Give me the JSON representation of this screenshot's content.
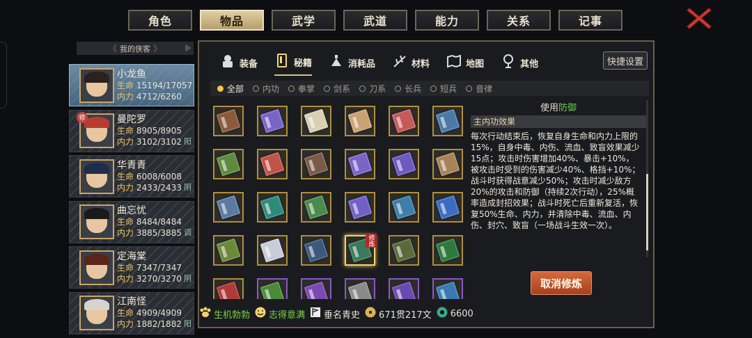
{
  "top_tabs": [
    {
      "label": "角色",
      "active": false
    },
    {
      "label": "物品",
      "active": true
    },
    {
      "label": "武学",
      "active": false
    },
    {
      "label": "武道",
      "active": false
    },
    {
      "label": "能力",
      "active": false
    },
    {
      "label": "关系",
      "active": false
    },
    {
      "label": "记事",
      "active": false
    }
  ],
  "close_icon": "close-x-icon",
  "left": {
    "header_label": "我的侠客",
    "characters": [
      {
        "name": "小龙鱼",
        "hp_label": "生命",
        "hp": "15194/17057",
        "mp_label": "内力",
        "mp": "4712/6260",
        "tag": "",
        "selected": true,
        "badge": "",
        "hair": "#2a221c"
      },
      {
        "name": "曼陀罗",
        "hp_label": "生命",
        "hp": "8905/8905",
        "mp_label": "内力",
        "mp": "3102/3102",
        "tag": "阳",
        "selected": false,
        "badge": "修",
        "hair": "#b83b32"
      },
      {
        "name": "华青青",
        "hp_label": "生命",
        "hp": "6008/6008",
        "mp_label": "内力",
        "mp": "2433/2433",
        "tag": "阴",
        "selected": false,
        "badge": "",
        "hair": "#1e2d4a"
      },
      {
        "name": "曲忘忧",
        "hp_label": "生命",
        "hp": "8484/8484",
        "mp_label": "内力",
        "mp": "3885/3885",
        "tag": "调",
        "selected": false,
        "badge": "",
        "hair": "#1a1a1a"
      },
      {
        "name": "定海棠",
        "hp_label": "生命",
        "hp": "7347/7347",
        "mp_label": "内力",
        "mp": "3270/3270",
        "tag": "阴",
        "selected": false,
        "badge": "",
        "hair": "#5a2418"
      },
      {
        "name": "江南怪",
        "hp_label": "生命",
        "hp": "4909/4909",
        "mp_label": "内力",
        "mp": "1882/1882",
        "tag": "阳",
        "selected": false,
        "badge": "",
        "hair": "#d7d4cc"
      }
    ]
  },
  "category_tabs": [
    {
      "label": "装备",
      "icon": "armor-icon",
      "active": false
    },
    {
      "label": "秘籍",
      "icon": "scroll-book-icon",
      "active": true
    },
    {
      "label": "消耗品",
      "icon": "potion-icon",
      "active": false
    },
    {
      "label": "材料",
      "icon": "herb-icon",
      "active": false
    },
    {
      "label": "地图",
      "icon": "map-icon",
      "active": false
    },
    {
      "label": "其他",
      "icon": "other-icon",
      "active": false
    }
  ],
  "quick_settings": "快捷设置",
  "filters": [
    {
      "label": "全部",
      "on": true
    },
    {
      "label": "内功",
      "on": false
    },
    {
      "label": "拳掌",
      "on": false
    },
    {
      "label": "剑系",
      "on": false
    },
    {
      "label": "刀系",
      "on": false
    },
    {
      "label": "长兵",
      "on": false
    },
    {
      "label": "短兵",
      "on": false
    },
    {
      "label": "音律",
      "on": false
    }
  ],
  "books": [
    {
      "color": "#8a5a3a",
      "frame": "gold"
    },
    {
      "color": "#7a64c8",
      "frame": "gold"
    },
    {
      "color": "#d9cfb4",
      "frame": "gold"
    },
    {
      "color": "#c8a272",
      "frame": "gold"
    },
    {
      "color": "#c45a5a",
      "frame": "gold"
    },
    {
      "color": "#4a7aa8",
      "frame": "gold"
    },
    {
      "color": "#5e8a3e",
      "frame": "gold"
    },
    {
      "color": "#c0544a",
      "frame": "gold"
    },
    {
      "color": "#7a5a48",
      "frame": "gold"
    },
    {
      "color": "#7c64c6",
      "frame": "gold"
    },
    {
      "color": "#6c5ac0",
      "frame": "gold"
    },
    {
      "color": "#a8835a",
      "frame": "gold"
    },
    {
      "color": "#5a7aa0",
      "frame": "gold"
    },
    {
      "color": "#2f8a7a",
      "frame": "gold"
    },
    {
      "color": "#4a8a4e",
      "frame": "gold"
    },
    {
      "color": "#7060c4",
      "frame": "gold"
    },
    {
      "color": "#3e7ea8",
      "frame": "gold"
    },
    {
      "color": "#3c6cc0",
      "frame": "gold"
    },
    {
      "color": "#6a8a3a",
      "frame": "gold"
    },
    {
      "color": "#c8ccd8",
      "frame": "gold"
    },
    {
      "color": "#3a5a7a",
      "frame": "gold"
    },
    {
      "color": "#3a7a5a",
      "frame": "gold",
      "selected": true,
      "mark": "修炼"
    },
    {
      "color": "#5a6a3a",
      "frame": "gold"
    },
    {
      "color": "#2e7a3e",
      "frame": "gold"
    },
    {
      "color": "#b03a3a",
      "frame": "gold"
    },
    {
      "color": "#4a8a3a",
      "frame": "purple"
    },
    {
      "color": "#7a4ab0",
      "frame": "purple"
    },
    {
      "color": "#8a8a8a",
      "frame": "purple"
    },
    {
      "color": "#6a4ab0",
      "frame": "purple"
    },
    {
      "color": "#3a7ab0",
      "frame": "purple"
    }
  ],
  "detail": {
    "use_prefix": "使用",
    "use_value": "防御",
    "effect_title": "主内功效果",
    "description": "每次行动结束后，恢复自身生命和内力上限的15%，自身中毒、内伤、流血、致盲效果减少15点；攻击时伤害增加40%、暴击+10%，被攻击时受到的伤害减少40%、格挡+10%；战斗时获得战意减少50%；攻击时减少敌方20%的攻击和防御（持续2次行动），25%概率造成封招效果；战斗时死亡后重新复活，恢复50%生命、内力，并清除中毒、流血、内伤、封穴、致盲（一场战斗生效一次）。",
    "cancel_button": "取消修炼"
  },
  "status": [
    {
      "label": "生机勃勃",
      "color": "#7bd24a",
      "icon": "paw-icon"
    },
    {
      "label": "志得意满",
      "color": "#7bd24a",
      "icon": "face-icon"
    },
    {
      "label": "垂名青史",
      "color": "#e8e2d4",
      "icon": "flag-icon"
    },
    {
      "label": "671贯217文",
      "color": "#e8e2d4",
      "icon": "coin-icon"
    },
    {
      "label": "6600",
      "color": "#e8e2d4",
      "icon": "jade-icon"
    }
  ]
}
